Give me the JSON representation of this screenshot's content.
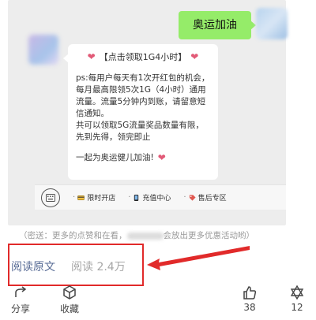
{
  "chat": {
    "my_message": "奥运加油",
    "card": {
      "title": "【点击领取1G4小时】",
      "body": "ps:每用户每天有1次开红包的机会，每月最高限领5次1G（4小时）通用流量。流量5分钟内到账，请留意短信通知。\n共可以领取5G流量奖品数量有限，先到先得，领完即止",
      "footer": "一起为奥运健儿加油!"
    },
    "menu": [
      {
        "label": "限时开店",
        "icon": "card-icon"
      },
      {
        "label": "充值中心",
        "icon": "phone-icon"
      },
      {
        "label": "售后专区",
        "icon": "tag-icon"
      }
    ]
  },
  "notice": {
    "before": "（密送：更多的点赞和在看，",
    "after": "会放出更多优惠活动哟）"
  },
  "article_stats": {
    "read_original": "阅读原文",
    "read_count": "阅读 2.4万"
  },
  "actions": {
    "share": "分享",
    "favorite": "收藏",
    "like_count": "38",
    "wow_count": "12"
  },
  "colors": {
    "highlight_box": "#e12a2a",
    "link": "#576b95",
    "my_bubble": "#95ec69"
  }
}
